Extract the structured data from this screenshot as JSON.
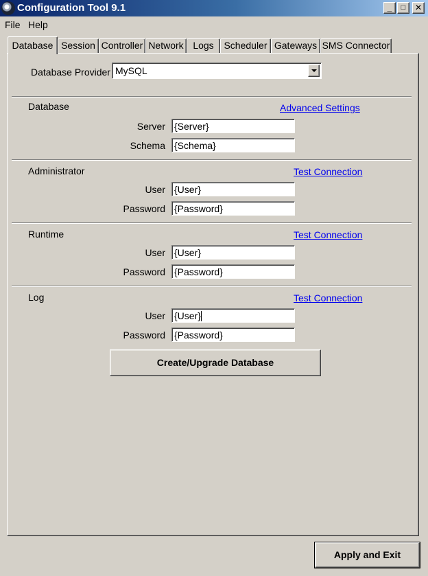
{
  "window": {
    "title": "Configuration Tool 9.1",
    "controls": {
      "minimize": "_",
      "maximize": "□",
      "close": "✕"
    }
  },
  "menu": [
    "File",
    "Help"
  ],
  "tabs": [
    {
      "label": "Database",
      "active": true
    },
    {
      "label": "Session"
    },
    {
      "label": "Controller"
    },
    {
      "label": "Network"
    },
    {
      "label": "Logs"
    },
    {
      "label": "Scheduler"
    },
    {
      "label": "Gateways"
    },
    {
      "label": "SMS Connector"
    }
  ],
  "provider": {
    "label": "Database Provider",
    "value": "MySQL"
  },
  "database": {
    "heading": "Database",
    "link": "Advanced Settings",
    "server_label": "Server",
    "server_value": "{Server}",
    "schema_label": "Schema",
    "schema_value": "{Schema}"
  },
  "administrator": {
    "heading": "Administrator",
    "link": "Test Connection",
    "user_label": "User",
    "user_value": "{User}",
    "password_label": "Password",
    "password_value": "{Password}"
  },
  "runtime": {
    "heading": "Runtime",
    "link": "Test Connection",
    "user_label": "User",
    "user_value": "{User}",
    "password_label": "Password",
    "password_value": "{Password}"
  },
  "log": {
    "heading": "Log",
    "link": "Test Connection",
    "user_label": "User",
    "user_value": "{User}",
    "password_label": "Password",
    "password_value": "{Password}"
  },
  "create_button": "Create/Upgrade Database",
  "apply_button": "Apply and Exit",
  "colors": {
    "face": "#d4d0c8",
    "title_start": "#0a246a",
    "title_end": "#a6caf0",
    "link": "#0000ee"
  }
}
